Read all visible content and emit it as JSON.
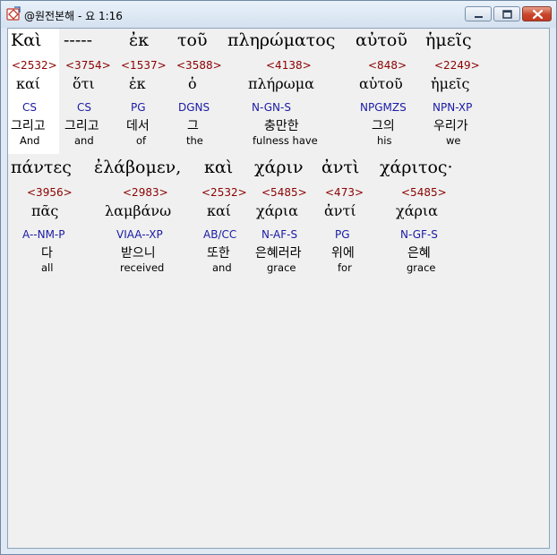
{
  "window": {
    "title": "@원전본해 - 요 1:16"
  },
  "lines": [
    {
      "words": [
        {
          "greek": "Καὶ",
          "strong": "<2532>",
          "lemma": "καί",
          "morph": "CS",
          "korean": "그리고",
          "english": "And"
        },
        {
          "greek": "-----",
          "strong": "<3754>",
          "lemma": "ὅτι",
          "morph": "CS",
          "korean": "그리고",
          "english": "and"
        },
        {
          "greek": "ἐκ",
          "strong": "<1537>",
          "lemma": "ἐκ",
          "morph": "PG",
          "korean": "데서",
          "english": "of"
        },
        {
          "greek": "τοῦ",
          "strong": "<3588>",
          "lemma": "ὁ",
          "morph": "DGNS",
          "korean": "그",
          "english": "the"
        },
        {
          "greek": "πληρώματος",
          "strong": "<4138>",
          "lemma": "πλήρωμα",
          "morph": "N-GN-S",
          "korean": "충만한",
          "english": "fulness have"
        },
        {
          "greek": "αὐτοῦ",
          "strong": "<848>",
          "lemma": "αὑτοῦ",
          "morph": "NPGMZS",
          "korean": "그의",
          "english": "his"
        },
        {
          "greek": "ἡμεῖς",
          "strong": "<2249>",
          "lemma": "ἡμεῖς",
          "morph": "NPN-XP",
          "korean": "우리가",
          "english": "we"
        }
      ]
    },
    {
      "words": [
        {
          "greek": "πάντες",
          "strong": "<3956>",
          "lemma": "πᾶς",
          "morph": "A--NM-P",
          "korean": "다",
          "english": "all"
        },
        {
          "greek": "ἐλάβομεν,",
          "strong": "<2983>",
          "lemma": "λαμβάνω",
          "morph": "VIAA--XP",
          "korean": "받으니",
          "english": "received"
        },
        {
          "greek": "καὶ",
          "strong": "<2532>",
          "lemma": "καί",
          "morph": "AB/CC",
          "korean": "또한",
          "english": "and"
        },
        {
          "greek": "χάριν",
          "strong": "<5485>",
          "lemma": "χάρια",
          "morph": "N-AF-S",
          "korean": "은혜러라",
          "english": "grace"
        },
        {
          "greek": "ἀντὶ",
          "strong": "<473>",
          "lemma": "ἀντί",
          "morph": "PG",
          "korean": "위에",
          "english": "for"
        },
        {
          "greek": "χάριτος·",
          "strong": "<5485>",
          "lemma": "χάρια",
          "morph": "N-GF-S",
          "korean": "은혜",
          "english": "grace"
        }
      ]
    }
  ]
}
